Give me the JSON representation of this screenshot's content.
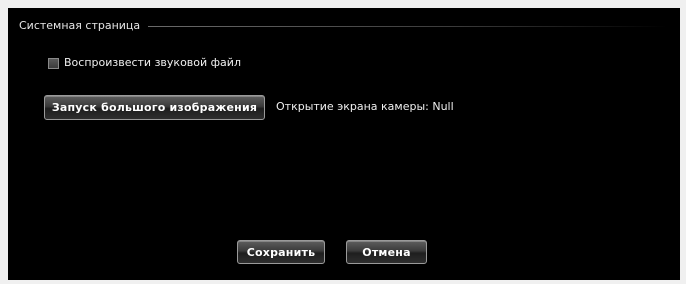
{
  "group": {
    "title": "Системная страница"
  },
  "sound_option": {
    "label": "Воспроизвести звуковой файл",
    "checked": false
  },
  "launch": {
    "button_label": "Запуск большого изображения",
    "status_text": "Открытие экрана камеры: Null"
  },
  "footer": {
    "save_label": "Сохранить",
    "cancel_label": "Отмена"
  }
}
